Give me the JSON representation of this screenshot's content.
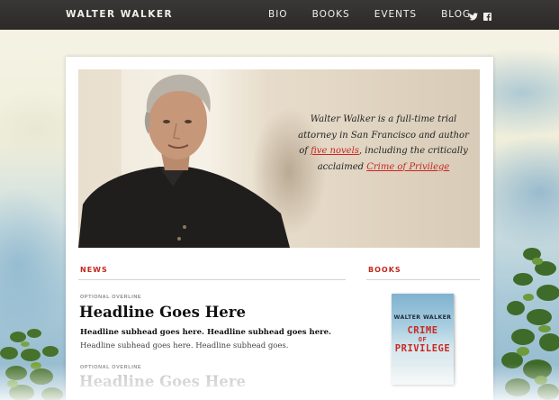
{
  "header": {
    "brand": "WALTER WALKER",
    "nav": [
      "BIO",
      "BOOKS",
      "EVENTS",
      "BLOG"
    ],
    "social_icons": [
      "twitter-icon",
      "facebook-icon"
    ]
  },
  "hero": {
    "text_before": "Walter Walker is a full-time trial attorney in San Francisco and author of ",
    "link_five_novels": "five novels",
    "text_middle": ", including the critically acclaimed ",
    "link_book": "Crime of Privilege"
  },
  "news": {
    "heading": "NEWS",
    "items": [
      {
        "overline": "OPTIONAL OVERLINE",
        "headline": "Headline Goes Here",
        "subhead_bold": "Headline subhead goes here. Headline subhead goes here.",
        "subhead_regular": "Headline subhead goes here. Headline subhead goes."
      },
      {
        "overline": "OPTIONAL OVERLINE",
        "headline": "Headline Goes Here"
      }
    ]
  },
  "books": {
    "heading": "BOOKS",
    "cover": {
      "author": "WALTER WALKER",
      "title_line1": "CRIME",
      "title_line2": "OF",
      "title_line3": "PRIVILEGE"
    }
  },
  "colors": {
    "accent": "#c0281e",
    "topbar": "#2f2d2b"
  }
}
